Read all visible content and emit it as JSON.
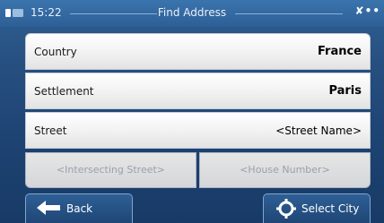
{
  "status_bar": {
    "time": "15:22",
    "title": "Find Address",
    "gps_indicator": "✘••"
  },
  "fields": [
    {
      "label": "Country",
      "value": "France"
    },
    {
      "label": "Settlement",
      "value": "Paris"
    },
    {
      "label": "Street",
      "value": "<Street Name>"
    }
  ],
  "intersecting_street_placeholder": "<Intersecting Street>",
  "house_number_placeholder": "<House Number>",
  "buttons": {
    "back_label": "Back",
    "select_city_label": "Select City"
  },
  "colors": {
    "background": "#264f80",
    "row_background": "#f1f1f1",
    "button_background": "#2e5f95"
  },
  "icons": {
    "back": "left-arrow-icon",
    "select_city": "crosshair-target-icon",
    "battery": "battery-icon",
    "gps": "gps-signal-icon"
  }
}
